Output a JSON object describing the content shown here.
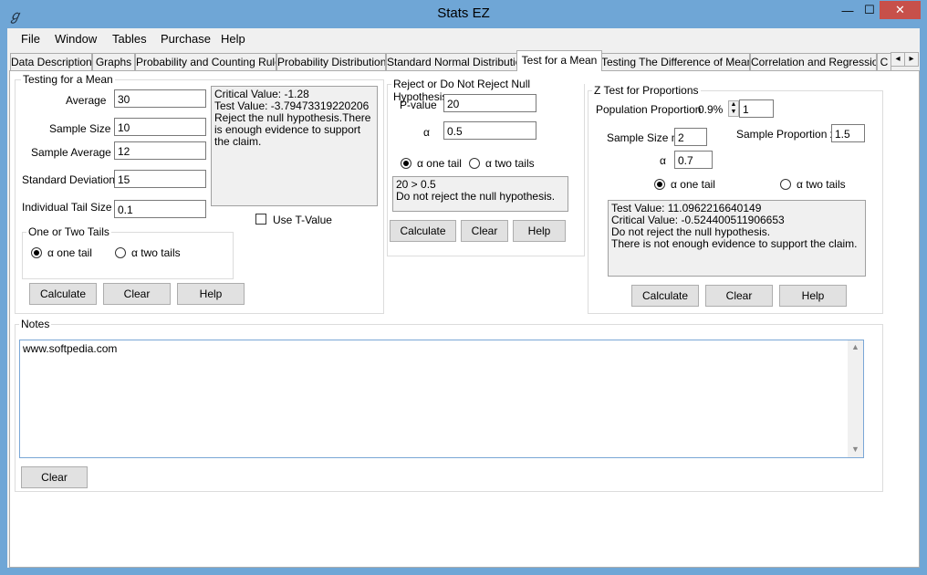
{
  "window": {
    "title": "Stats EZ",
    "app_icon": "app-icon",
    "minimize_label": "—",
    "maximize_label": "☐",
    "close_label": "✕"
  },
  "menu": [
    "File",
    "Window",
    "Tables",
    "Purchase",
    "Help"
  ],
  "tabs": [
    "Data Description",
    "Graphs",
    "Probability and Counting Rules",
    "Probability Distributions",
    "Standard Normal Distribution",
    "Test for a Mean",
    "Testing The Difference of Means",
    "Correlation and Regression",
    "C"
  ],
  "tab_scroll": {
    "left": "◂",
    "right": "▸"
  },
  "testing_mean": {
    "title": "Testing for a Mean",
    "fields": [
      {
        "label": "Average",
        "value": "30"
      },
      {
        "label": "Sample Size",
        "value": "10"
      },
      {
        "label": "Sample Average",
        "value": "12"
      },
      {
        "label": "Standard Deviation",
        "value": "15"
      },
      {
        "label": "Individual Tail Size",
        "value": "0.1"
      }
    ],
    "output": "Critical Value: -1.28\nTest Value: -3.79473319220206\nReject the null hypothesis.There is enough evidence to support the claim.",
    "use_t_value": "Use T-Value",
    "tails_title": "One or Two Tails",
    "one_tail": "α one tail",
    "two_tails": "α two tails",
    "buttons": {
      "calculate": "Calculate",
      "clear": "Clear",
      "help": "Help"
    }
  },
  "reject": {
    "title": "Reject or Do Not Reject Null Hypothesis",
    "pvalue_label": "P-value",
    "pvalue": "20",
    "alpha_label": "α",
    "alpha": "0.5",
    "one_tail": "α one tail",
    "two_tails": "α two tails",
    "output": "20 > 0.5\nDo not reject the null hypothesis.",
    "buttons": {
      "calculate": "Calculate",
      "clear": "Clear",
      "help": "Help"
    }
  },
  "ztest": {
    "title": "Z Test for Proportions",
    "pop_label": "Population Proportion",
    "pop_percent": "0.9%",
    "pop_value": "1",
    "sample_size_label": "Sample Size n",
    "sample_size": "2",
    "sample_prop_label": "Sample Proportion x",
    "sample_prop": "1.5",
    "alpha_label": "α",
    "alpha": "0.7",
    "one_tail": "α one tail",
    "two_tails": "α two tails",
    "output": "Test Value: 11.0962216640149\nCritical Value: -0.524400511906653\nDo not reject the null hypothesis.\nThere is not enough evidence to support the claim.",
    "buttons": {
      "calculate": "Calculate",
      "clear": "Clear",
      "help": "Help"
    }
  },
  "notes": {
    "title": "Notes",
    "text": "www.softpedia.com",
    "clear": "Clear"
  }
}
